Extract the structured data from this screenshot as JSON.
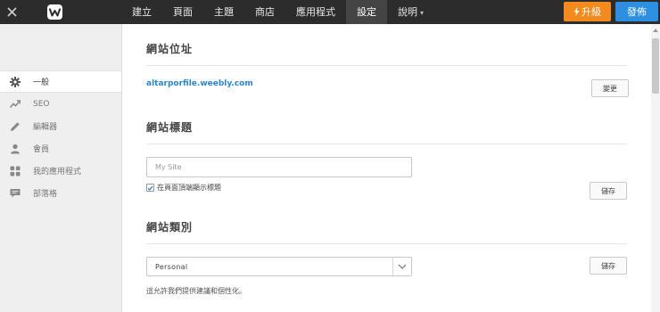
{
  "topbar": {
    "nav": [
      {
        "label": "建立",
        "active": false
      },
      {
        "label": "頁面",
        "active": false
      },
      {
        "label": "主題",
        "active": false
      },
      {
        "label": "商店",
        "active": false
      },
      {
        "label": "應用程式",
        "active": false
      },
      {
        "label": "設定",
        "active": true
      },
      {
        "label": "說明",
        "active": false
      }
    ],
    "upgrade_label": "升級",
    "publish_label": "發佈",
    "colors": {
      "bar": "#2c2c2c",
      "upgrade": "#f28a1e",
      "publish": "#2d8fe0"
    }
  },
  "sidebar": {
    "items": [
      {
        "label": "一般",
        "icon": "gear-icon",
        "active": true
      },
      {
        "label": "SEO",
        "icon": "trend-icon",
        "active": false
      },
      {
        "label": "編輯器",
        "icon": "pencil-icon",
        "active": false
      },
      {
        "label": "會員",
        "icon": "user-icon",
        "active": false
      },
      {
        "label": "我的應用程式",
        "icon": "apps-grid-icon",
        "active": false
      },
      {
        "label": "部落格",
        "icon": "comment-icon",
        "active": false
      }
    ]
  },
  "main": {
    "site_address": {
      "title": "網站位址",
      "url": "altarporfile.weebly.com",
      "change_label": "變更"
    },
    "site_title": {
      "title": "網站標題",
      "input_placeholder": "My Site",
      "checkbox_label": "在頁面頂端顯示標題",
      "checkbox_checked": true,
      "save_label": "儲存"
    },
    "site_category": {
      "title": "網站類別",
      "selected": "Personal",
      "save_label": "儲存",
      "helper": "這允許我們提供建議和個性化。"
    }
  }
}
